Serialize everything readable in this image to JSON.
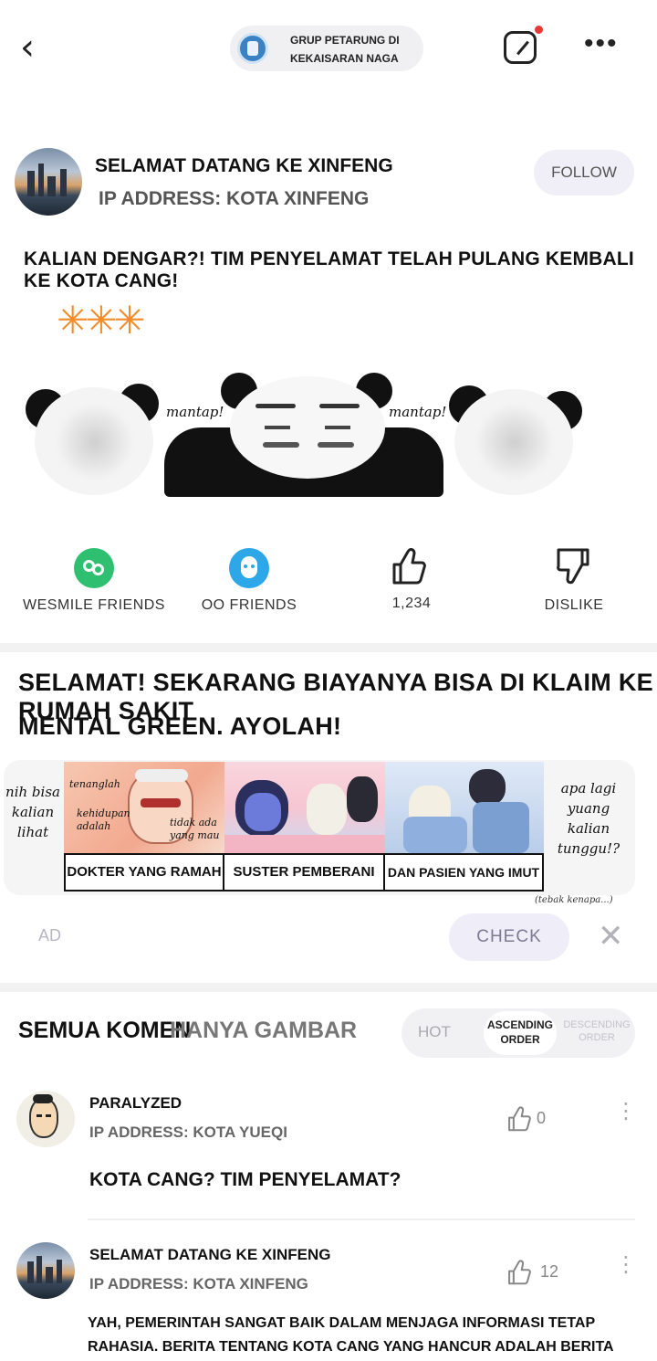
{
  "header": {
    "group_name": "GRUP PETARUNG DI KEKAISARAN NAGA"
  },
  "post": {
    "author": "SELAMAT DATANG KE XINFENG",
    "ip": "IP ADDRESS: KOTA XINFENG",
    "follow_label": "FOLLOW",
    "text": "KALIAN DENGAR?! TIM PENYELAMAT TELAH PULANG KEMBALI KE KOTA CANG!",
    "sparks": "✳✳✳",
    "meme_captions": [
      "mantap!",
      "mantap!"
    ]
  },
  "actions": [
    {
      "label": "WESMILE FRIENDS",
      "icon": "wesmile-icon",
      "color": "#2fbf71"
    },
    {
      "label": "OO FRIENDS",
      "icon": "oo-icon",
      "color": "#2da7e8"
    },
    {
      "label": "1,234",
      "icon": "thumbs-up-icon"
    },
    {
      "label": "DISLIKE",
      "icon": "thumbs-down-icon"
    }
  ],
  "ad": {
    "title_line1": "SELAMAT! SEKARANG BIAYANYA BISA DI KLAIM KE RUMAH SAKIT",
    "title_line2": "MENTAL GREEN. AYOLAH!",
    "left_text": [
      "nih bisa",
      "kalian",
      "lihat"
    ],
    "right_text": [
      "apa lagi",
      "yuang",
      "kalian",
      "tunggu!?"
    ],
    "panel1_bubbles": [
      "tenanglah",
      "kehidupan",
      "adalah",
      "tidak ada",
      "yang mau"
    ],
    "captions": [
      "DOKTER YANG RAMAH",
      "SUSTER PEMBERANI",
      "DAN PASIEN YANG IMUT"
    ],
    "footnote": "(tebak kenapa...)",
    "tag": "AD",
    "check_label": "CHECK"
  },
  "comments_section": {
    "tabs": [
      "SEMUA KOMEN",
      "HANYA GAMBAR"
    ],
    "sort": {
      "hot": "HOT",
      "asc_line1": "ASCENDING",
      "asc_line2": "ORDER",
      "desc_line1": "DESCENDING",
      "desc_line2": "ORDER"
    },
    "comments": [
      {
        "name": "PARALYZED",
        "ip": "IP ADDRESS: KOTA YUEQI",
        "likes": "0",
        "text": "KOTA CANG? TIM PENYELAMAT?"
      },
      {
        "name": "SELAMAT DATANG KE XINFENG",
        "ip": "IP ADDRESS: KOTA XINFENG",
        "likes": "12",
        "text_line1": "YAH, PEMERINTAH SANGAT BAIK DALAM MENJAGA INFORMASI TETAP",
        "text_line2": "RAHASIA. BERITA TENTANG KOTA CANG YANG HANCUR ADALAH BERITA"
      }
    ]
  }
}
